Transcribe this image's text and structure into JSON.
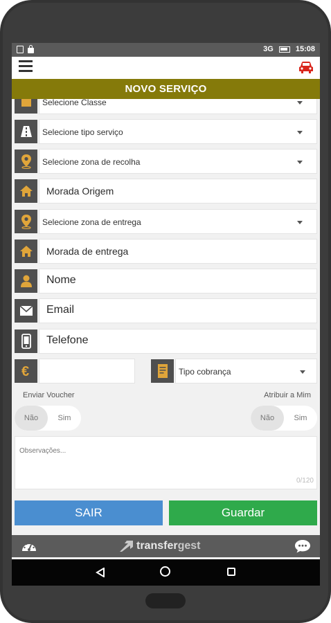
{
  "statusbar": {
    "network": "3G",
    "time": "15:08"
  },
  "title": "NOVO SERVIÇO",
  "form": {
    "classe": {
      "label": "Selecione Classe",
      "icon": "car-class-icon"
    },
    "tipo_servico": {
      "label": "Selecione tipo serviço",
      "icon": "road-icon"
    },
    "zona_recolha": {
      "label": "Selecione zona de recolha",
      "icon": "map-pin-icon"
    },
    "morada_origem": {
      "placeholder": "Morada Origem",
      "icon": "home-icon"
    },
    "zona_entrega": {
      "label": "Selecione zona de entrega",
      "icon": "map-pin-icon"
    },
    "morada_entrega": {
      "placeholder": "Morada de entrega",
      "icon": "home-icon"
    },
    "nome": {
      "placeholder": "Nome",
      "icon": "user-icon"
    },
    "email": {
      "placeholder": "Email",
      "icon": "envelope-icon"
    },
    "telefone": {
      "placeholder": "Telefone",
      "icon": "mobile-phone-icon"
    },
    "valor": {
      "value": "",
      "icon": "euro-icon"
    },
    "tipo_cobranca": {
      "label": "Tipo cobrança",
      "icon": "document-icon"
    },
    "enviar_voucher": {
      "label": "Enviar Voucher",
      "off": "Não",
      "on": "Sim",
      "selected": "Não"
    },
    "atribuir_mim": {
      "label": "Atribuir a Mim",
      "off": "Não",
      "on": "Sim",
      "selected": "Não"
    },
    "observacoes": {
      "placeholder": "Observações...",
      "counter": "0/120"
    }
  },
  "buttons": {
    "sair": "SAIR",
    "guardar": "Guardar"
  },
  "footer": {
    "brand_part1": "transfer",
    "brand_part2": "gest"
  },
  "colors": {
    "title_bar": "#857a0a",
    "sair_button": "#4a8ed0",
    "guardar_button": "#2faa4b",
    "icon_accent": "#e0a53a",
    "car_icon": "#d9261c"
  }
}
